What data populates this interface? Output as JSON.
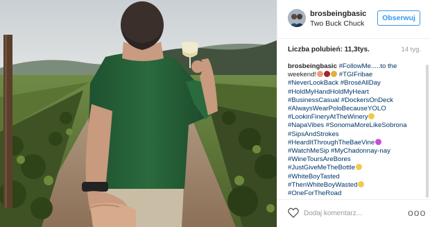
{
  "post": {
    "author": "brosbeingbasic",
    "location": "Two Buck Chuck",
    "follow_label": "Obserwuj",
    "likes_label": "Liczba polubień: 11,3tys.",
    "time_ago": "14 tyg.",
    "caption_lines": [
      "#FollowMe.....to the",
      "weekend!",
      "#TGIFribae",
      "#NeverLookBack #BroséAllDay",
      "#HoldMyHandHoldMyHeart",
      "#BusinessCasual #DockersOnDeck",
      "#AlwaysWearPoloBecauseYOLO",
      "#LookinFineryAtTheWinery",
      "#NapaVibes #SonomaMoreLikeSobrona",
      "#SipsAndStrokes",
      "#HeardItThroughTheBaeVine",
      "#WatchMeSip #MyChadonnay-nay",
      "#WineToursAreBores",
      "#JustGiveMeTheBottle",
      "#WhiteBoyTasted",
      "#ThenWhiteBoyWasted",
      "#OneForTheRoad"
    ],
    "comment_placeholder": "Dodaj komentarz...",
    "more_label": "ooo"
  },
  "colors": {
    "link": "#003569",
    "follow": "#3897f0",
    "text": "#262626",
    "muted": "#999999",
    "divider": "#efefef"
  },
  "icons": {
    "like": "heart-outline-icon",
    "more": "more-options-icon",
    "photo_emojis": [
      "woman-emoji",
      "wine-glass-emoji",
      "party-popper-emoji",
      "smirk-emoji",
      "kiss-emoji",
      "grimace-emoji",
      "dizzy-face-emoji"
    ]
  }
}
